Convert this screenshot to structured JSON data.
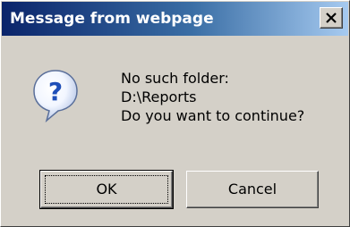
{
  "window": {
    "title": "Message from webpage"
  },
  "controls": {
    "close_icon": "close-icon"
  },
  "dialog": {
    "icon": "question-icon",
    "message_lines": [
      "No such folder:",
      "D:\\Reports",
      "Do you want to continue?"
    ]
  },
  "buttons": {
    "ok_label": "OK",
    "cancel_label": "Cancel"
  },
  "colors": {
    "titlebar_start": "#0a246a",
    "titlebar_end": "#a6caf0",
    "dialog_face": "#d4d0c8",
    "icon_blue": "#2f6fd8"
  }
}
